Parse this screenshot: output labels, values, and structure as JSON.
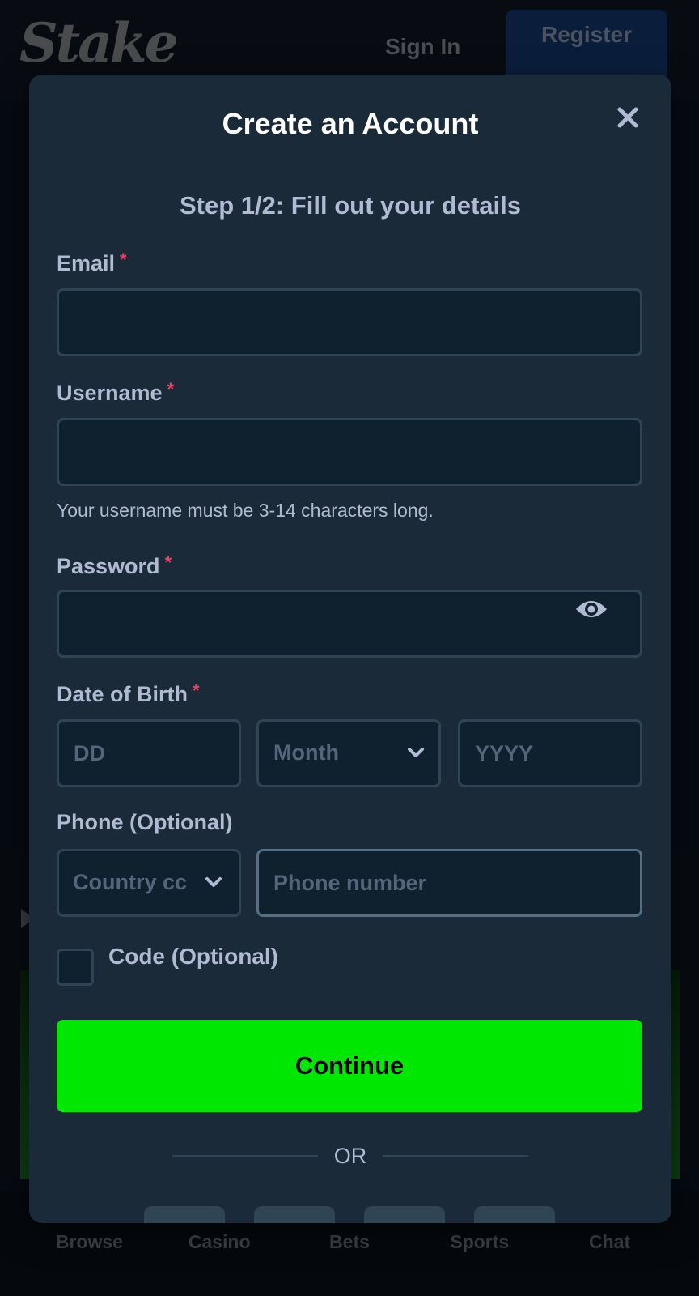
{
  "header": {
    "logo_text": "Stake",
    "sign_in_label": "Sign In",
    "register_label": "Register"
  },
  "modal": {
    "title": "Create an Account",
    "step_text": "Step 1/2: Fill out your details",
    "required_marker": "*",
    "fields": {
      "email": {
        "label": "Email",
        "value": "",
        "placeholder": ""
      },
      "username": {
        "label": "Username",
        "value": "",
        "placeholder": "",
        "hint": "Your username must be 3-14 characters long."
      },
      "password": {
        "label": "Password",
        "value": "",
        "placeholder": ""
      },
      "dob": {
        "label": "Date of Birth",
        "day_placeholder": "DD",
        "month_placeholder": "Month",
        "year_placeholder": "YYYY"
      },
      "phone": {
        "label": "Phone (Optional)",
        "country_code_placeholder": "Country cc",
        "number_placeholder": "Phone number"
      },
      "code": {
        "label": "Code (Optional)",
        "checked": false
      }
    },
    "continue_label": "Continue",
    "or_text": "OR",
    "social_buttons": [
      "social-1",
      "social-2",
      "social-3",
      "social-4"
    ]
  },
  "bottom_nav": [
    {
      "label": "Browse",
      "icon": "browse-icon"
    },
    {
      "label": "Casino",
      "icon": "casino-cards-icon"
    },
    {
      "label": "Bets",
      "icon": "bets-slip-icon"
    },
    {
      "label": "Sports",
      "icon": "sports-ball-icon"
    },
    {
      "label": "Chat",
      "icon": "chat-bubble-icon"
    }
  ],
  "colors": {
    "accent_green": "#00e701",
    "modal_bg": "#1b2a38",
    "input_bg": "#0f212e",
    "input_border": "#2f4553",
    "label_text": "#b1bad3",
    "required_red": "#ed4163",
    "register_bg": "#0a1e3c"
  }
}
